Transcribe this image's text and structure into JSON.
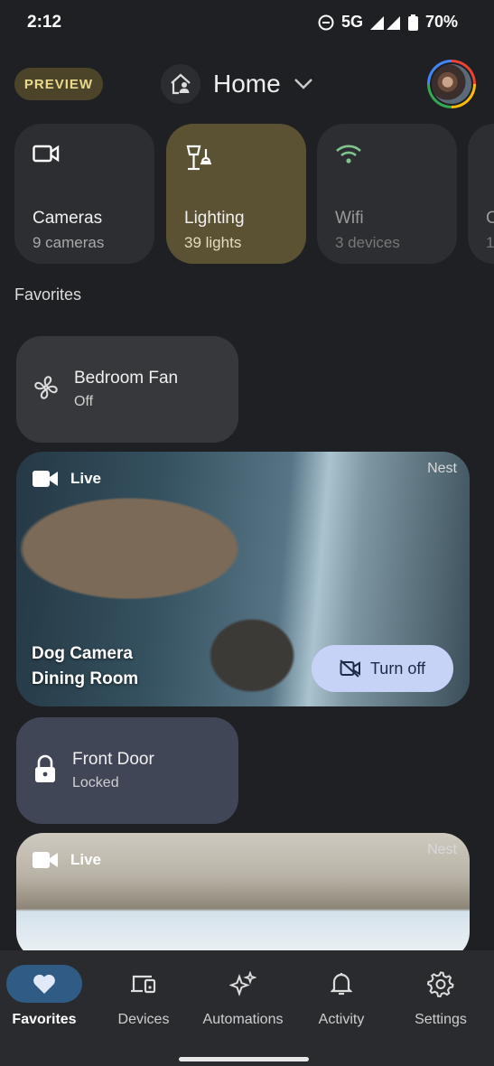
{
  "status_bar": {
    "time": "2:12",
    "network": "5G",
    "battery": "70%"
  },
  "header": {
    "badge": "PREVIEW",
    "home_name": "Home"
  },
  "categories": [
    {
      "title": "Cameras",
      "subtitle": "9 cameras",
      "icon": "video-camera-icon"
    },
    {
      "title": "Lighting",
      "subtitle": "39 lights",
      "icon": "lamp-icon"
    },
    {
      "title": "Wifi",
      "subtitle": "3 devices",
      "icon": "wifi-icon"
    },
    {
      "title": "C",
      "subtitle": "1",
      "icon": "category-icon"
    }
  ],
  "favorites": {
    "title": "Favorites",
    "fan": {
      "name": "Bedroom Fan",
      "state": "Off"
    },
    "camera1": {
      "live": "Live",
      "brand": "Nest",
      "line1": "Dog Camera",
      "line2": "Dining Room",
      "action": "Turn off"
    },
    "lock": {
      "name": "Front Door",
      "state": "Locked"
    },
    "camera2": {
      "live": "Live",
      "brand": "Nest"
    }
  },
  "nav": [
    {
      "label": "Favorites",
      "icon": "heart-icon",
      "active": true
    },
    {
      "label": "Devices",
      "icon": "devices-icon"
    },
    {
      "label": "Automations",
      "icon": "sparkle-icon"
    },
    {
      "label": "Activity",
      "icon": "bell-icon"
    },
    {
      "label": "Settings",
      "icon": "gear-icon"
    }
  ],
  "colors": {
    "background": "#1f2023",
    "accent_active_category": "#5a5232",
    "nav_active_pill": "#2f5b84",
    "turn_off_button": "#c6d3f7"
  }
}
